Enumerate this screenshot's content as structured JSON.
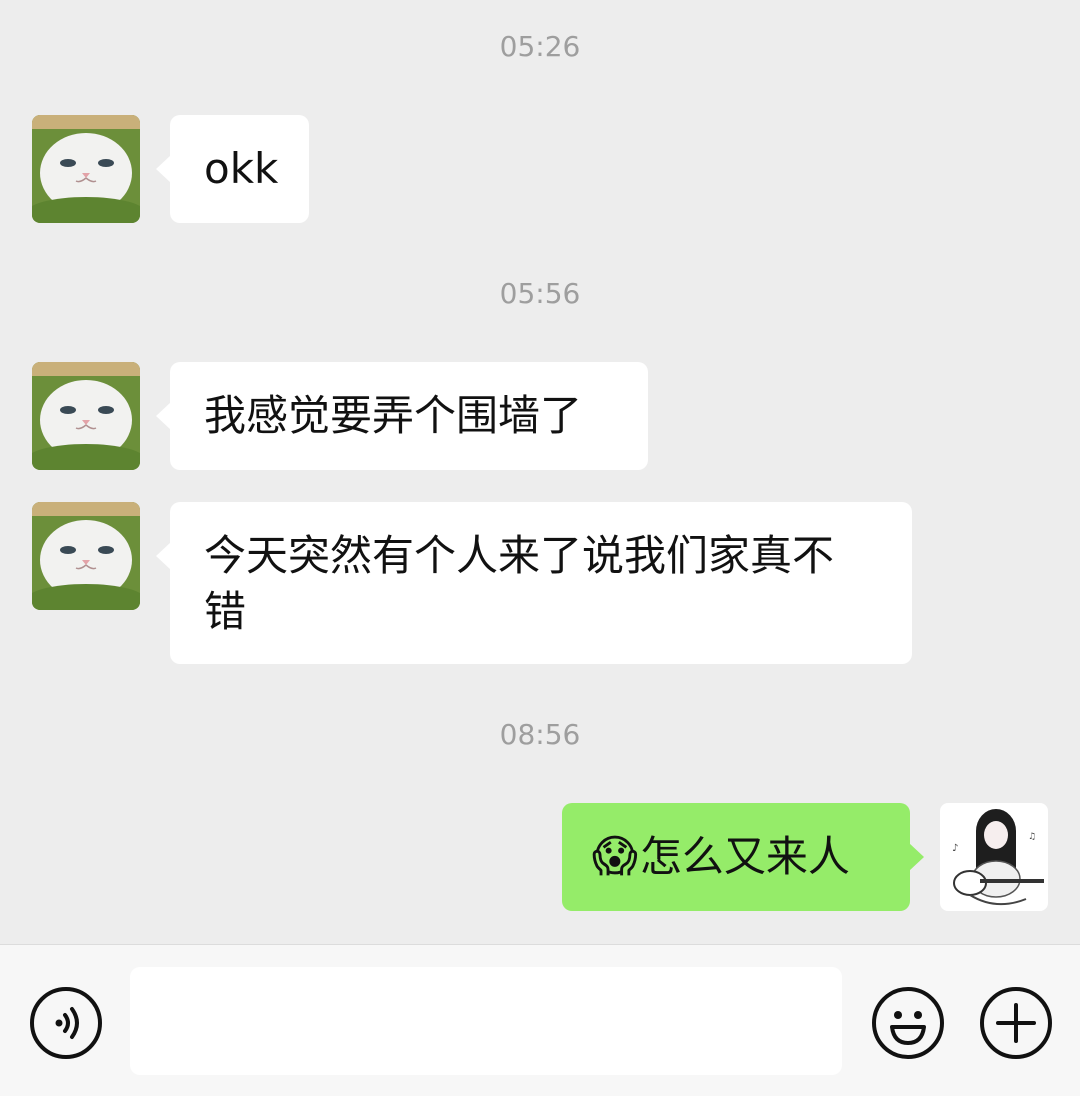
{
  "messages": {
    "time1": "05:26",
    "msg1": "okk",
    "time2": "05:56",
    "msg2": "我感觉要弄个围墙了",
    "msg3_line1": "今天突然有个人来了说我们家真不",
    "msg3_line2": "错",
    "time3": "08:56",
    "msg4_emoji": "😱",
    "msg4_text": "怎么又来人"
  },
  "contacts": {
    "other_avatar": "cat-avatar",
    "self_avatar": "anime-girl-guitar-avatar"
  },
  "input_bar": {
    "voice_icon": "voice-icon",
    "text_value": "",
    "emoji_icon": "emoji-icon",
    "plus_icon": "plus-icon"
  },
  "colors": {
    "background": "#ededed",
    "incoming_bubble": "#ffffff",
    "outgoing_bubble": "#95ec69",
    "timestamp": "#9e9e9e"
  }
}
